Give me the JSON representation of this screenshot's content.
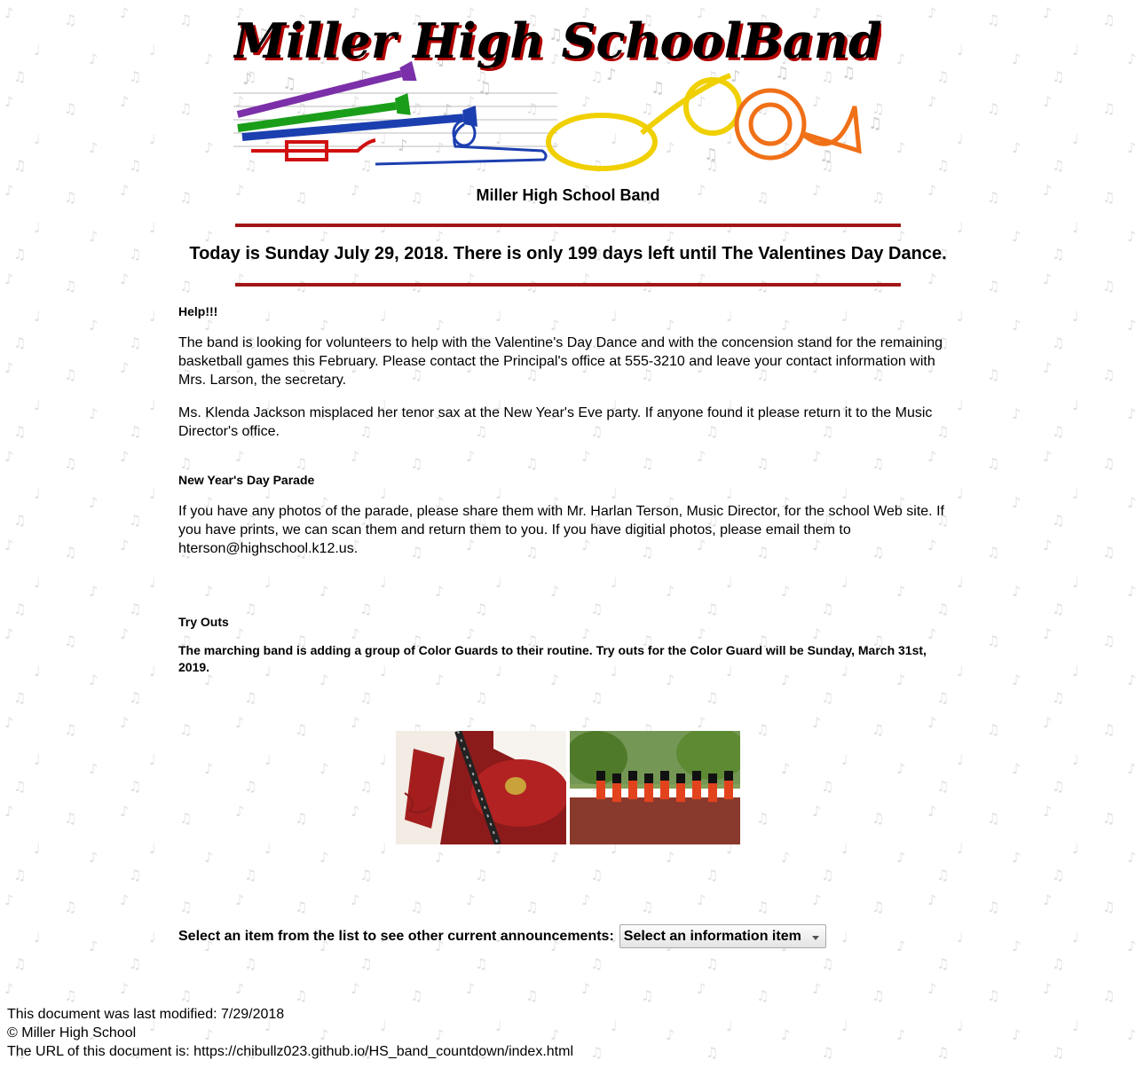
{
  "banner": {
    "logo_text": "Miller High SchoolBand",
    "colors": {
      "title_shadow": "#b00000",
      "instruments": [
        "#7b2fa8",
        "#1a9e1a",
        "#1c3fb0",
        "#d01010",
        "#f0e000",
        "#f07018"
      ]
    }
  },
  "header": {
    "subtitle": "Miller High School Band",
    "countdown": "Today is Sunday July 29, 2018. There is only 199 days left until The Valentines Day Dance."
  },
  "announcements": [
    {
      "heading": "Help!!!",
      "paragraphs": [
        "The band is looking for volunteers to help with the Valentine's Day Dance and with the concension stand for the remaining basketball games this February. Please contact the Principal's office at 555-3210 and leave your contact information with Mrs. Larson, the secretary.",
        "Ms. Klenda Jackson misplaced her tenor sax at the New Year's Eve party. If anyone found it please return it to the Music Director's office."
      ]
    },
    {
      "heading": "New Year's Day Parade",
      "paragraphs": [
        "If you have any photos of the parade, please share them with Mr. Harlan Terson, Music Director, for the school Web site. If you have prints, we can scan them and return them to you. If you have digitial photos, please email them to hterson@highschool.k12.us."
      ]
    },
    {
      "heading": "Try Outs",
      "paragraphs": [
        "The marching band is adding a group of Color Guards to their routine. Try outs for the Color Guard will be Sunday, March 31st, 2019."
      ]
    }
  ],
  "photos": {
    "photo1": "band-uniform-clarinet-photo",
    "photo2": "marching-guards-parade-photo"
  },
  "select_section": {
    "label": "Select an item from the list to see other current announcements:",
    "selected": "Select an information item"
  },
  "footer": {
    "modified": "This document was last modified: 7/29/2018",
    "copyright": "© Miller High School",
    "url": "The URL of this document is: https://chibullz023.github.io/HS_band_countdown/index.html"
  },
  "colors": {
    "rule": "#a31616",
    "background_notes": "#dcdcdc"
  }
}
